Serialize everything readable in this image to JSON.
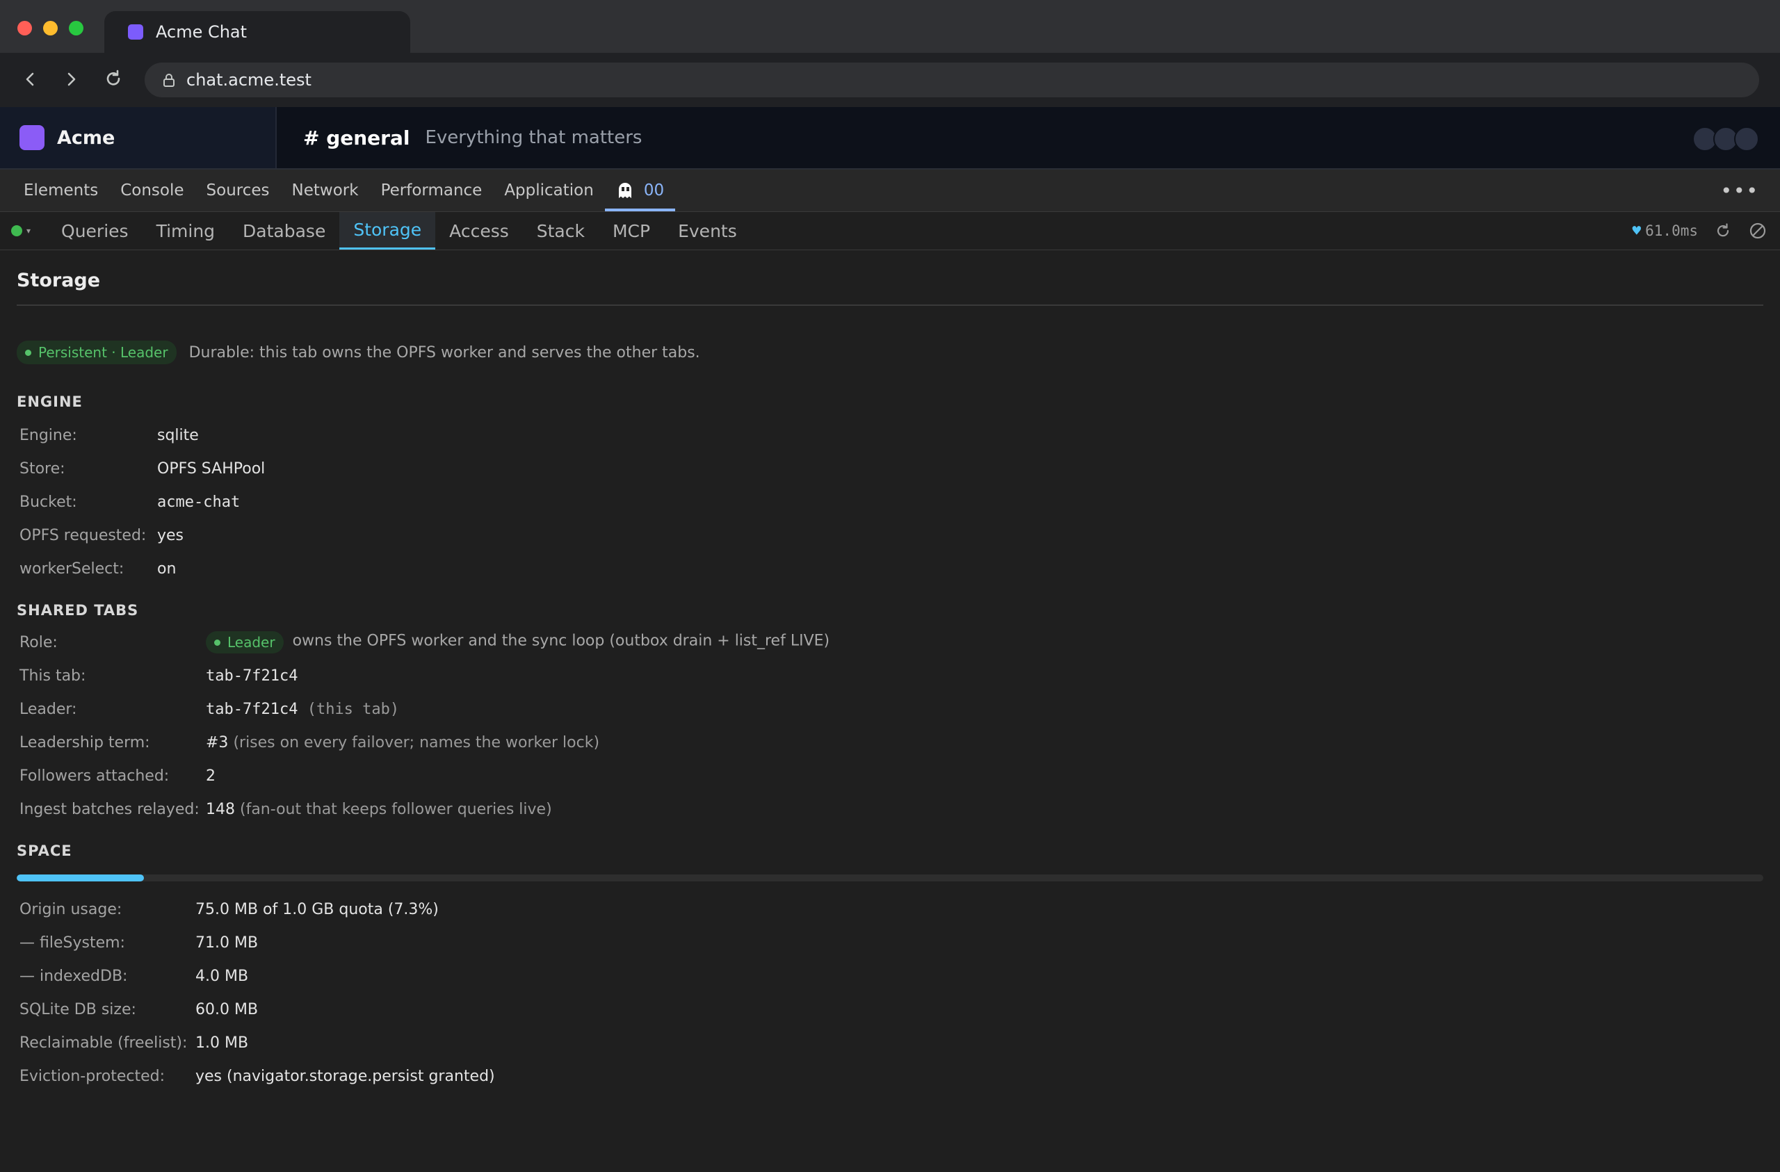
{
  "browser": {
    "tab_title": "Acme Chat",
    "url": "chat.acme.test"
  },
  "app": {
    "brand": "Acme",
    "channel": "# general",
    "topic": "Everything that matters"
  },
  "devtools": {
    "tabs": [
      "Elements",
      "Console",
      "Sources",
      "Network",
      "Performance",
      "Application"
    ],
    "extension_tab_label": "00",
    "sub_tabs": [
      "Queries",
      "Timing",
      "Database",
      "Storage",
      "Access",
      "Stack",
      "MCP",
      "Events"
    ],
    "active_sub_tab": "Storage",
    "timing": "61.0ms",
    "status_color": "#3fb950"
  },
  "storage": {
    "title": "Storage",
    "mode_badge": "Persistent · Leader",
    "mode_desc": "Durable: this tab owns the OPFS worker and serves the other tabs.",
    "engine": {
      "title": "ENGINE",
      "rows": [
        {
          "key": "Engine:",
          "value": "sqlite"
        },
        {
          "key": "Store:",
          "value": "OPFS SAHPool"
        },
        {
          "key": "Bucket:",
          "value": "acme-chat"
        },
        {
          "key": "OPFS requested:",
          "value": "yes"
        },
        {
          "key": "workerSelect:",
          "value": "on"
        }
      ]
    },
    "shared_tabs": {
      "title": "SHARED TABS",
      "role_key": "Role:",
      "role_badge": "Leader",
      "role_desc": "owns the OPFS worker and the sync loop (outbox drain + list_ref LIVE)",
      "this_tab_key": "This tab:",
      "this_tab_value": "tab-7f21c4",
      "leader_key": "Leader:",
      "leader_value": "tab-7f21c4",
      "leader_note": "(this tab)",
      "term_key": "Leadership term:",
      "term_value": "#3",
      "term_note": "(rises on every failover; names the worker lock)",
      "followers_key": "Followers attached:",
      "followers_value": "2",
      "ingest_key": "Ingest batches relayed:",
      "ingest_value": "148",
      "ingest_note": "(fan-out that keeps follower queries live)"
    },
    "space": {
      "title": "SPACE",
      "usage_fraction": 0.073,
      "rows": [
        {
          "key": "Origin usage:",
          "value": "75.0 MB of 1.0 GB quota (7.3%)"
        },
        {
          "key": "— fileSystem:",
          "value": "71.0 MB"
        },
        {
          "key": "— indexedDB:",
          "value": "4.0 MB"
        },
        {
          "key": "SQLite DB size:",
          "value": "60.0 MB"
        },
        {
          "key": "Reclaimable (freelist):",
          "value": "1.0 MB"
        },
        {
          "key": "Eviction-protected:",
          "value": "yes (navigator.storage.persist granted)"
        }
      ]
    }
  }
}
